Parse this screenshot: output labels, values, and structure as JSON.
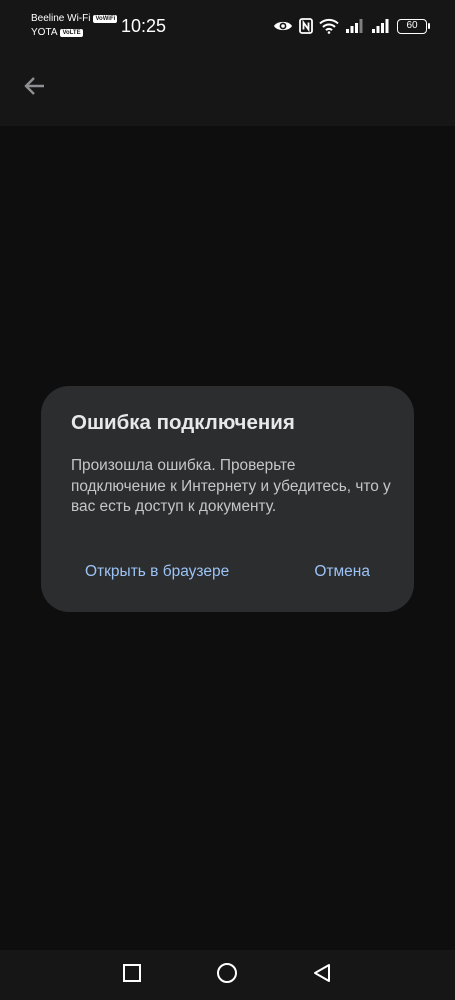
{
  "status_bar": {
    "carrier_1": "Beeline Wi-Fi",
    "carrier_1_tag": "VoWiFi",
    "carrier_2": "YOTA",
    "carrier_2_tag": "VoLTE",
    "time": "10:25",
    "battery_level": "60",
    "icons": [
      "eye-icon",
      "nfc-icon",
      "wifi-icon",
      "signal-icon",
      "signal-icon",
      "battery-icon"
    ]
  },
  "app_bar": {
    "back_icon": "arrow-left-icon"
  },
  "dialog": {
    "title": "Ошибка подключения",
    "message": "Произошла ошибка. Проверьте подключение к Интернету и убедитесь, что у вас есть доступ к документу.",
    "open_in_browser_label": "Открыть в браузере",
    "cancel_label": "Отмена"
  },
  "nav_bar": {
    "icons": [
      "square-icon",
      "circle-icon",
      "triangle-back-icon"
    ]
  },
  "colors": {
    "background": "#0e0e0f",
    "bar": "#161617",
    "dialog": "#2b2d2f",
    "accent": "#9cc3f5"
  }
}
